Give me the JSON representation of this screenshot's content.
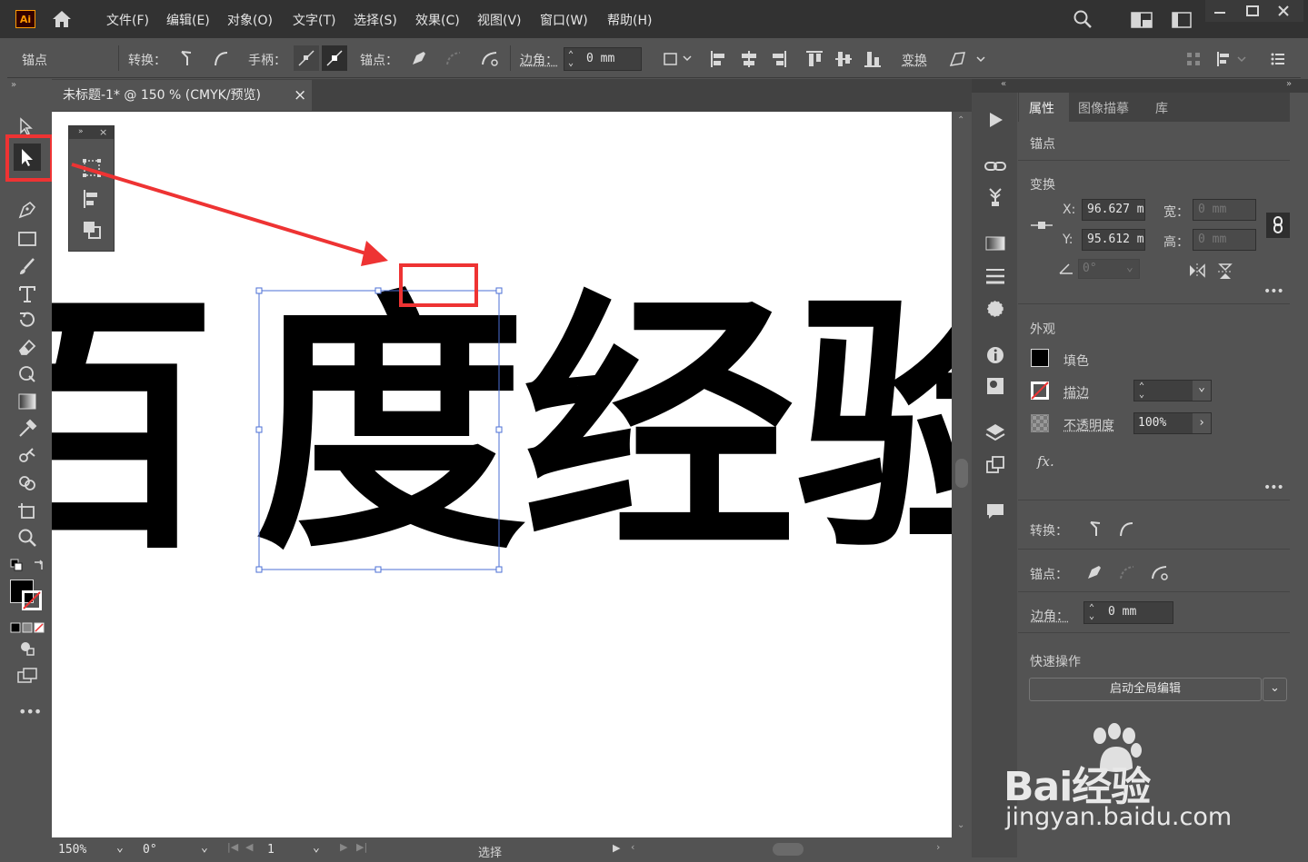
{
  "app": {
    "logo": "Ai"
  },
  "menu": [
    "文件(F)",
    "编辑(E)",
    "对象(O)",
    "文字(T)",
    "选择(S)",
    "效果(C)",
    "视图(V)",
    "窗口(W)",
    "帮助(H)"
  ],
  "control_bar": {
    "anchor_label": "锚点",
    "convert_label": "转换：",
    "handle_label": "手柄：",
    "anchor_points_label": "锚点：",
    "corner_label": "边角：",
    "corner_value": "0 mm",
    "transform_label": "变换"
  },
  "document_tab": {
    "title": "未标题-1* @ 150 % (CMYK/预览)",
    "close": "×"
  },
  "canvas_text": [
    "百",
    "度",
    "经",
    "验"
  ],
  "right_panel": {
    "tabs": [
      "属性",
      "图像描摹",
      "库"
    ],
    "selection_type": "锚点",
    "transform": {
      "title": "变换",
      "x_label": "X:",
      "x_value": "96.627 m",
      "y_label": "Y:",
      "y_value": "95.612 m",
      "w_label": "宽：",
      "w_value": "0 mm",
      "h_label": "高：",
      "h_value": "0 mm",
      "angle_value": "0°"
    },
    "appearance": {
      "title": "外观",
      "fill_label": "填色",
      "stroke_label": "描边",
      "opacity_label": "不透明度",
      "opacity_value": "100%",
      "fx_label": "fx."
    },
    "convert_label": "转换：",
    "anchor_label": "锚点：",
    "corner_label": "边角：",
    "corner_value": "0 mm",
    "quick_actions": {
      "title": "快速操作",
      "button": "启动全局编辑"
    }
  },
  "status_bar": {
    "zoom": "150%",
    "rotation": "0°",
    "artboard": "1",
    "tool": "选择"
  },
  "watermark": {
    "line1": "Bai经验",
    "line2": "jingyan.baidu.com"
  },
  "colors": {
    "annotation_red": "#ee3333",
    "ui_dark": "#323232",
    "ui_mid": "#535353"
  }
}
